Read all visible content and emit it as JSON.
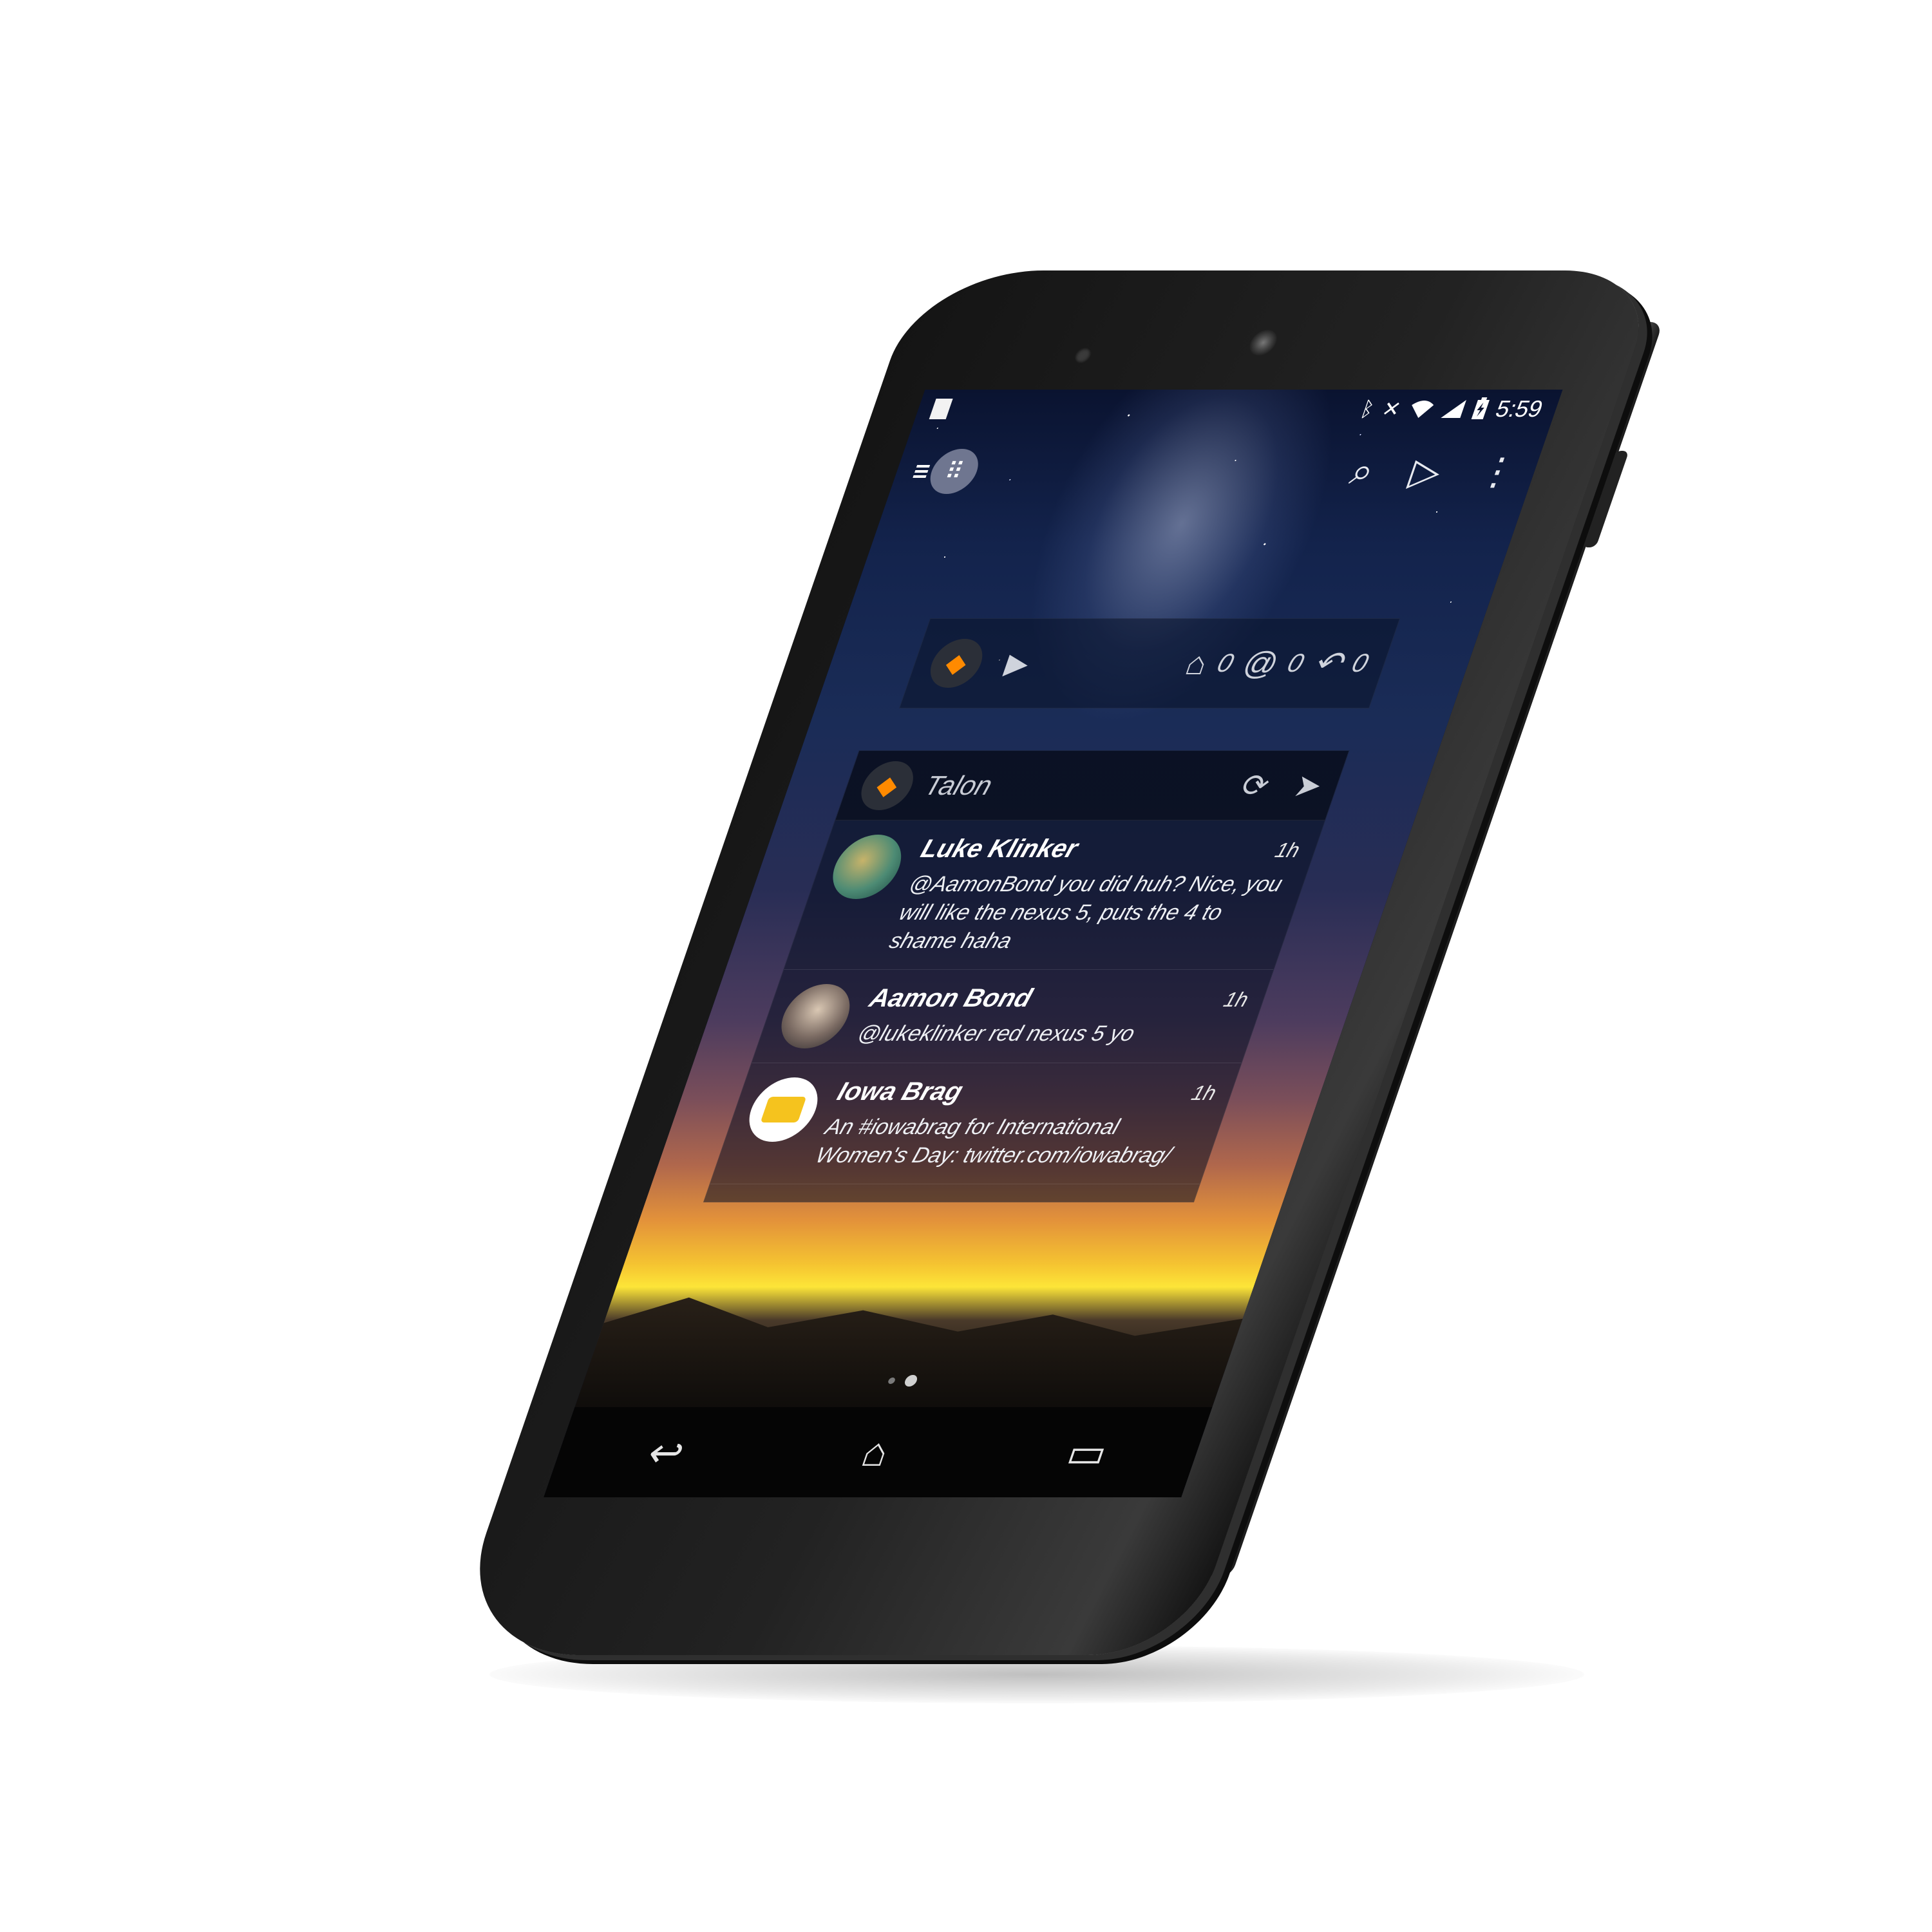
{
  "status_bar": {
    "time": "5:59",
    "icons": [
      "bluetooth-icon",
      "mute-icon",
      "wifi-icon",
      "signal-icon",
      "battery-charging-icon"
    ]
  },
  "launcher": {
    "icons": [
      "menu-icon",
      "apps-icon",
      "search-icon",
      "play-store-icon",
      "overflow-menu-icon"
    ]
  },
  "widget_bar": {
    "counts": [
      {
        "icon": "home-icon",
        "value": "0"
      },
      {
        "icon": "at-icon",
        "value": "0"
      },
      {
        "icon": "reply-icon",
        "value": "0"
      }
    ]
  },
  "timeline": {
    "title": "Talon",
    "tweets": [
      {
        "name": "Luke Klinker",
        "time": "1h",
        "text": "@AamonBond you did huh? Nice, you will like the nexus 5, puts the 4 to shame haha"
      },
      {
        "name": "Aamon Bond",
        "time": "1h",
        "text": "@lukeklinker red nexus 5 yo"
      },
      {
        "name": "Iowa Brag",
        "time": "1h",
        "text": "An #iowabrag for International Women's Day: twitter.com/iowabrag/"
      }
    ]
  },
  "home_pages": {
    "count": 2,
    "active_index": 1
  },
  "nav_bar": {
    "icons": [
      "back-icon",
      "home-icon",
      "recents-icon"
    ]
  },
  "colors": {
    "accent": "#ff8a00",
    "iowa_yellow": "#f5c31e",
    "sunset": "#fde538"
  }
}
